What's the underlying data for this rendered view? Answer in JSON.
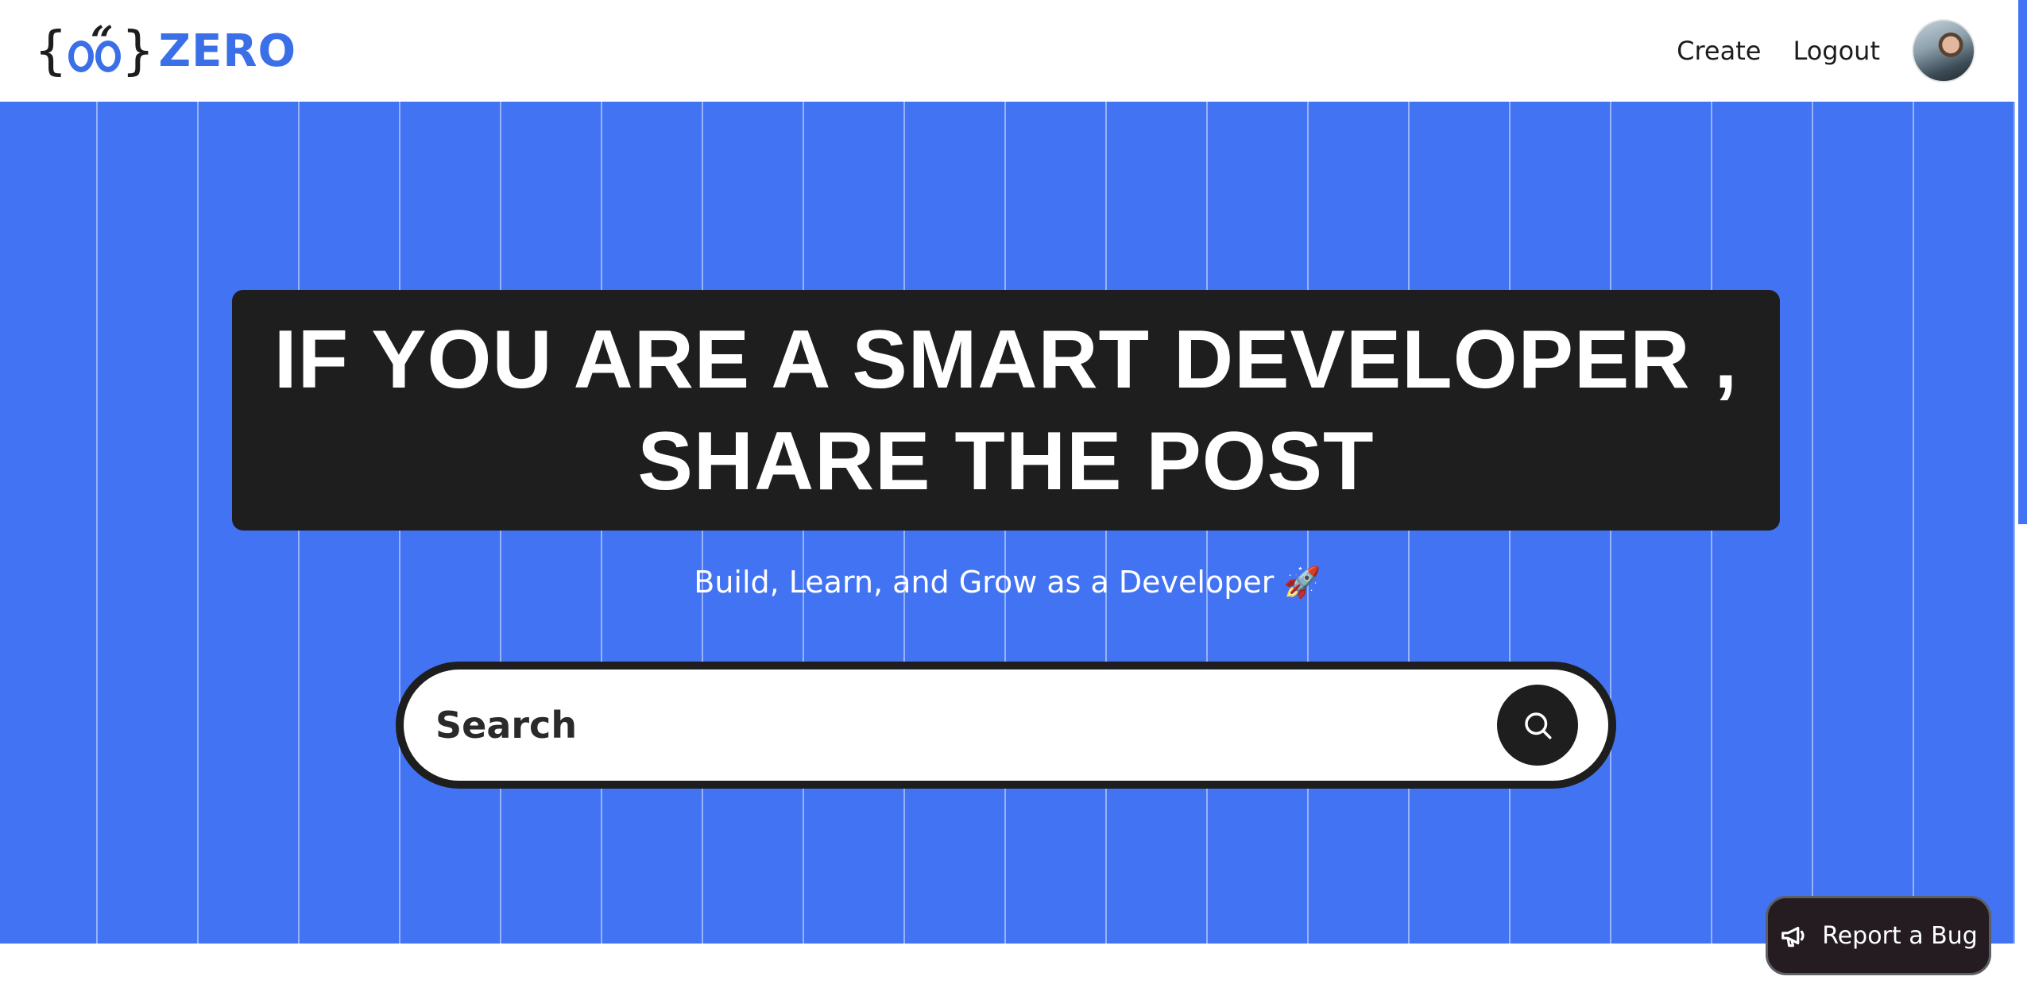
{
  "header": {
    "logo": {
      "brace_left": "{",
      "quote": "“",
      "brace_right": "}",
      "word": "ZERO"
    },
    "nav": {
      "create_label": "Create",
      "logout_label": "Logout"
    },
    "avatar_icon": "user-avatar-photo"
  },
  "hero": {
    "headline_line1": "IF YOU ARE A SMART DEVELOPER ,",
    "headline_line2": "SHARE THE POST",
    "tagline": "Build, Learn, and Grow as a Developer 🚀",
    "search": {
      "placeholder": "Search",
      "value": "",
      "icon": "search-icon"
    }
  },
  "report_bug": {
    "label": "Report a Bug",
    "icon": "megaphone-icon"
  },
  "colors": {
    "accent": "#4273f3",
    "dark": "#1e1e1e",
    "text": "#1d1d1d",
    "background": "#ffffff"
  }
}
